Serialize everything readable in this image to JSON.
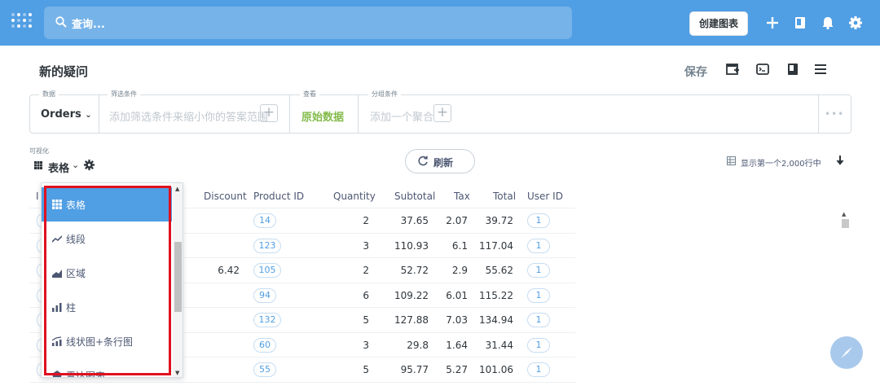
{
  "nav": {
    "search_placeholder": "查询...",
    "create_button": "创建图表"
  },
  "question": {
    "title": "新的疑问",
    "save": "保存"
  },
  "builder": {
    "data_label": "数据",
    "data_value": "Orders",
    "filter_label": "筛选条件",
    "filter_placeholder": "添加筛选条件来缩小你的答案范围",
    "view_label": "查看",
    "view_value": "原始数据",
    "group_label": "分组条件",
    "group_placeholder": "添加一个聚合",
    "more": "•••"
  },
  "viz": {
    "label": "可视化",
    "selected": "表格",
    "refresh": "刷新",
    "row_count": "显示第一个2,000行中"
  },
  "table": {
    "columns": [
      "I",
      "Discount",
      "Product ID",
      "Quantity",
      "Subtotal",
      "Tax",
      "Total",
      "User ID"
    ],
    "rows": [
      {
        "discount": "",
        "product_id": "14",
        "quantity": "2",
        "subtotal": "37.65",
        "tax": "2.07",
        "total": "39.72",
        "user_id": "1"
      },
      {
        "discount": "",
        "product_id": "123",
        "quantity": "3",
        "subtotal": "110.93",
        "tax": "6.1",
        "total": "117.04",
        "user_id": "1"
      },
      {
        "discount": "6.42",
        "product_id": "105",
        "quantity": "2",
        "subtotal": "52.72",
        "tax": "2.9",
        "total": "55.62",
        "user_id": "1"
      },
      {
        "discount": "",
        "product_id": "94",
        "quantity": "6",
        "subtotal": "109.22",
        "tax": "6.01",
        "total": "115.22",
        "user_id": "1"
      },
      {
        "discount": "",
        "product_id": "132",
        "quantity": "5",
        "subtotal": "127.88",
        "tax": "7.03",
        "total": "134.94",
        "user_id": "1"
      },
      {
        "discount": "",
        "product_id": "60",
        "quantity": "3",
        "subtotal": "29.8",
        "tax": "1.64",
        "total": "31.44",
        "user_id": "1"
      },
      {
        "discount": "",
        "product_id": "55",
        "quantity": "5",
        "subtotal": "95.77",
        "tax": "5.27",
        "total": "101.06",
        "user_id": "1"
      }
    ]
  },
  "dropdown": {
    "items": [
      {
        "label": "表格",
        "icon": "table-icon",
        "active": true
      },
      {
        "label": "线段",
        "icon": "line-chart-icon"
      },
      {
        "label": "区域",
        "icon": "area-chart-icon"
      },
      {
        "label": "柱",
        "icon": "bar-chart-icon"
      },
      {
        "label": "线状图+条行图",
        "icon": "combo-chart-icon"
      },
      {
        "label": "雷达图表",
        "icon": "radar-chart-icon"
      }
    ]
  },
  "colors": {
    "brand": "#509ee3",
    "highlight": "#e0101f",
    "raw_data_green": "#84bb4c"
  }
}
